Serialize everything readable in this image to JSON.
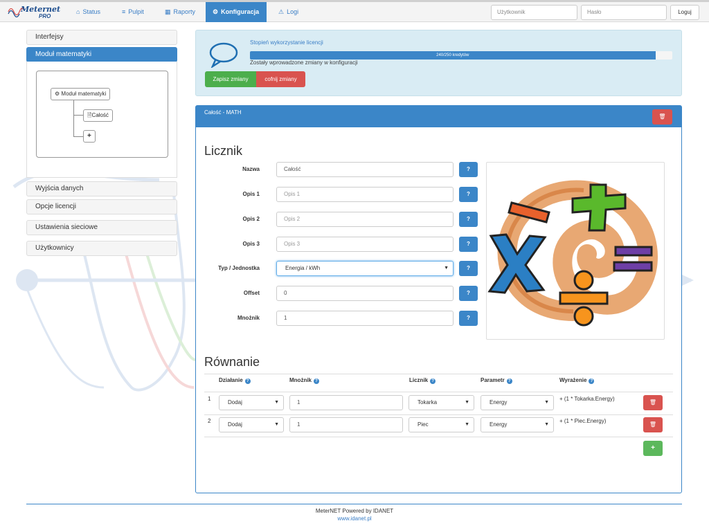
{
  "app": {
    "logo_text_1": "Meternet",
    "logo_text_2": "PRO"
  },
  "nav": {
    "items": [
      {
        "label": "Status",
        "icon": "home-icon"
      },
      {
        "label": "Pulpit",
        "icon": "list-icon"
      },
      {
        "label": "Raporty",
        "icon": "chart-icon"
      },
      {
        "label": "Konfiguracja",
        "icon": "gear-icon"
      },
      {
        "label": "Logi",
        "icon": "warning-icon"
      }
    ],
    "active": "Konfiguracja",
    "user_placeholder": "Użytkownik",
    "pass_placeholder": "Hasło",
    "login_label": "Loguj"
  },
  "sidebar": {
    "items": [
      {
        "label": "Interfejsy"
      },
      {
        "label": "Moduł matematyki"
      },
      {
        "label": "Wyjścia danych"
      },
      {
        "label": "Opcje licencji"
      },
      {
        "label": "Ustawienia sieciowe"
      },
      {
        "label": "Użytkownicy"
      }
    ],
    "tree": {
      "root": "Moduł matematyki",
      "child": "Całość",
      "add": "+"
    }
  },
  "license": {
    "label": "Stopień wykorzystanie licencji",
    "progress_text": "240/250 kredytów",
    "used": 240,
    "total": 250,
    "message": "Zostały wprowadzone zmiany w konfiguracji",
    "save_label": "Zapisz zmiany",
    "revert_label": "cofnij zmiany"
  },
  "panel": {
    "title": "Całość - MATH",
    "licznik_heading": "Licznik",
    "fields": [
      {
        "label": "Nazwa",
        "value": "Całość",
        "placeholder": false
      },
      {
        "label": "Opis 1",
        "value": "Opis 1",
        "placeholder": true
      },
      {
        "label": "Opis 2",
        "value": "Opis 2",
        "placeholder": true
      },
      {
        "label": "Opis 3",
        "value": "Opis 3",
        "placeholder": true
      },
      {
        "label": "Typ / Jednostka",
        "value": "Energia / kWh",
        "select": true
      },
      {
        "label": "Offset",
        "value": "0",
        "placeholder": false
      },
      {
        "label": "Mnożnik",
        "value": "1",
        "placeholder": false
      }
    ],
    "help_label": "?",
    "rownanie_heading": "Równanie",
    "columns": [
      "Działanie",
      "Mnożnik",
      "Licznik",
      "Parametr",
      "Wyrażenie"
    ],
    "rows": [
      {
        "num": "1",
        "op": "Dodaj",
        "mult": "1",
        "counter": "Tokarka",
        "param": "Energy",
        "expr": "+ (1 * Tokarka.Energy)"
      },
      {
        "num": "2",
        "op": "Dodaj",
        "mult": "1",
        "counter": "Piec",
        "param": "Energy",
        "expr": "+ (1 * Piec.Energy)"
      }
    ],
    "add_label": "+"
  },
  "footer": {
    "line1": "MeterNET Powered by IDANET",
    "line2": "www.idanet.pl"
  },
  "colors": {
    "primary": "#3b86c8",
    "success": "#5cb85c",
    "danger": "#d9534f",
    "info_bg": "#d9ecf4"
  }
}
